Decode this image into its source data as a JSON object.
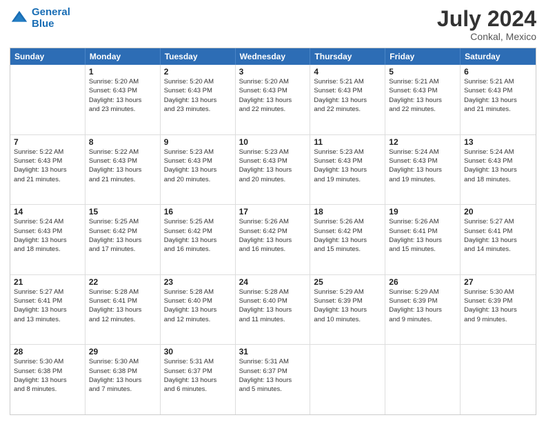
{
  "logo": {
    "line1": "General",
    "line2": "Blue"
  },
  "title": "July 2024",
  "subtitle": "Conkal, Mexico",
  "header_days": [
    "Sunday",
    "Monday",
    "Tuesday",
    "Wednesday",
    "Thursday",
    "Friday",
    "Saturday"
  ],
  "weeks": [
    [
      {
        "day": "",
        "info": ""
      },
      {
        "day": "1",
        "info": "Sunrise: 5:20 AM\nSunset: 6:43 PM\nDaylight: 13 hours\nand 23 minutes."
      },
      {
        "day": "2",
        "info": "Sunrise: 5:20 AM\nSunset: 6:43 PM\nDaylight: 13 hours\nand 23 minutes."
      },
      {
        "day": "3",
        "info": "Sunrise: 5:20 AM\nSunset: 6:43 PM\nDaylight: 13 hours\nand 22 minutes."
      },
      {
        "day": "4",
        "info": "Sunrise: 5:21 AM\nSunset: 6:43 PM\nDaylight: 13 hours\nand 22 minutes."
      },
      {
        "day": "5",
        "info": "Sunrise: 5:21 AM\nSunset: 6:43 PM\nDaylight: 13 hours\nand 22 minutes."
      },
      {
        "day": "6",
        "info": "Sunrise: 5:21 AM\nSunset: 6:43 PM\nDaylight: 13 hours\nand 21 minutes."
      }
    ],
    [
      {
        "day": "7",
        "info": "Sunrise: 5:22 AM\nSunset: 6:43 PM\nDaylight: 13 hours\nand 21 minutes."
      },
      {
        "day": "8",
        "info": "Sunrise: 5:22 AM\nSunset: 6:43 PM\nDaylight: 13 hours\nand 21 minutes."
      },
      {
        "day": "9",
        "info": "Sunrise: 5:23 AM\nSunset: 6:43 PM\nDaylight: 13 hours\nand 20 minutes."
      },
      {
        "day": "10",
        "info": "Sunrise: 5:23 AM\nSunset: 6:43 PM\nDaylight: 13 hours\nand 20 minutes."
      },
      {
        "day": "11",
        "info": "Sunrise: 5:23 AM\nSunset: 6:43 PM\nDaylight: 13 hours\nand 19 minutes."
      },
      {
        "day": "12",
        "info": "Sunrise: 5:24 AM\nSunset: 6:43 PM\nDaylight: 13 hours\nand 19 minutes."
      },
      {
        "day": "13",
        "info": "Sunrise: 5:24 AM\nSunset: 6:43 PM\nDaylight: 13 hours\nand 18 minutes."
      }
    ],
    [
      {
        "day": "14",
        "info": "Sunrise: 5:24 AM\nSunset: 6:43 PM\nDaylight: 13 hours\nand 18 minutes."
      },
      {
        "day": "15",
        "info": "Sunrise: 5:25 AM\nSunset: 6:42 PM\nDaylight: 13 hours\nand 17 minutes."
      },
      {
        "day": "16",
        "info": "Sunrise: 5:25 AM\nSunset: 6:42 PM\nDaylight: 13 hours\nand 16 minutes."
      },
      {
        "day": "17",
        "info": "Sunrise: 5:26 AM\nSunset: 6:42 PM\nDaylight: 13 hours\nand 16 minutes."
      },
      {
        "day": "18",
        "info": "Sunrise: 5:26 AM\nSunset: 6:42 PM\nDaylight: 13 hours\nand 15 minutes."
      },
      {
        "day": "19",
        "info": "Sunrise: 5:26 AM\nSunset: 6:41 PM\nDaylight: 13 hours\nand 15 minutes."
      },
      {
        "day": "20",
        "info": "Sunrise: 5:27 AM\nSunset: 6:41 PM\nDaylight: 13 hours\nand 14 minutes."
      }
    ],
    [
      {
        "day": "21",
        "info": "Sunrise: 5:27 AM\nSunset: 6:41 PM\nDaylight: 13 hours\nand 13 minutes."
      },
      {
        "day": "22",
        "info": "Sunrise: 5:28 AM\nSunset: 6:41 PM\nDaylight: 13 hours\nand 12 minutes."
      },
      {
        "day": "23",
        "info": "Sunrise: 5:28 AM\nSunset: 6:40 PM\nDaylight: 13 hours\nand 12 minutes."
      },
      {
        "day": "24",
        "info": "Sunrise: 5:28 AM\nSunset: 6:40 PM\nDaylight: 13 hours\nand 11 minutes."
      },
      {
        "day": "25",
        "info": "Sunrise: 5:29 AM\nSunset: 6:39 PM\nDaylight: 13 hours\nand 10 minutes."
      },
      {
        "day": "26",
        "info": "Sunrise: 5:29 AM\nSunset: 6:39 PM\nDaylight: 13 hours\nand 9 minutes."
      },
      {
        "day": "27",
        "info": "Sunrise: 5:30 AM\nSunset: 6:39 PM\nDaylight: 13 hours\nand 9 minutes."
      }
    ],
    [
      {
        "day": "28",
        "info": "Sunrise: 5:30 AM\nSunset: 6:38 PM\nDaylight: 13 hours\nand 8 minutes."
      },
      {
        "day": "29",
        "info": "Sunrise: 5:30 AM\nSunset: 6:38 PM\nDaylight: 13 hours\nand 7 minutes."
      },
      {
        "day": "30",
        "info": "Sunrise: 5:31 AM\nSunset: 6:37 PM\nDaylight: 13 hours\nand 6 minutes."
      },
      {
        "day": "31",
        "info": "Sunrise: 5:31 AM\nSunset: 6:37 PM\nDaylight: 13 hours\nand 5 minutes."
      },
      {
        "day": "",
        "info": ""
      },
      {
        "day": "",
        "info": ""
      },
      {
        "day": "",
        "info": ""
      }
    ]
  ]
}
